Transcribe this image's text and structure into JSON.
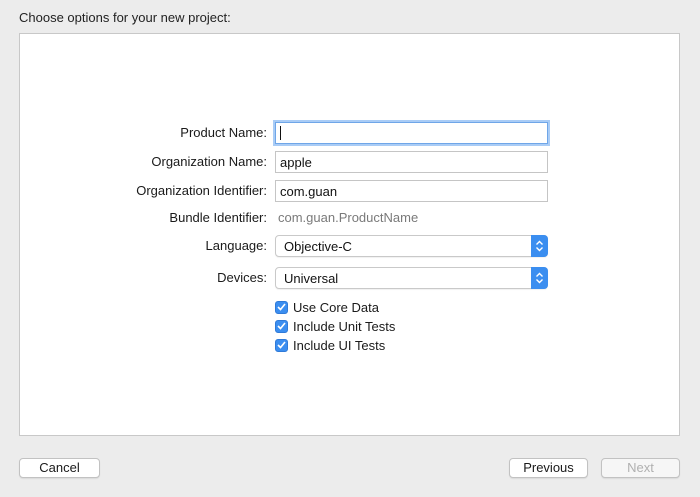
{
  "header": {
    "title": "Choose options for your new project:"
  },
  "form": {
    "product_name": {
      "label": "Product Name:",
      "value": ""
    },
    "organization_name": {
      "label": "Organization Name:",
      "value": "apple"
    },
    "organization_identifier": {
      "label": "Organization Identifier:",
      "value": "com.guan"
    },
    "bundle_identifier": {
      "label": "Bundle Identifier:",
      "value": "com.guan.ProductName"
    },
    "language": {
      "label": "Language:",
      "value": "Objective-C"
    },
    "devices": {
      "label": "Devices:",
      "value": "Universal"
    },
    "options": [
      {
        "label": "Use Core Data",
        "checked": true
      },
      {
        "label": "Include Unit Tests",
        "checked": true
      },
      {
        "label": "Include UI Tests",
        "checked": true
      }
    ]
  },
  "footer": {
    "cancel_label": "Cancel",
    "previous_label": "Previous",
    "next_label": "Next"
  },
  "colors": {
    "accent": "#3b8ef0",
    "focus_ring": "#a9ccf6"
  }
}
